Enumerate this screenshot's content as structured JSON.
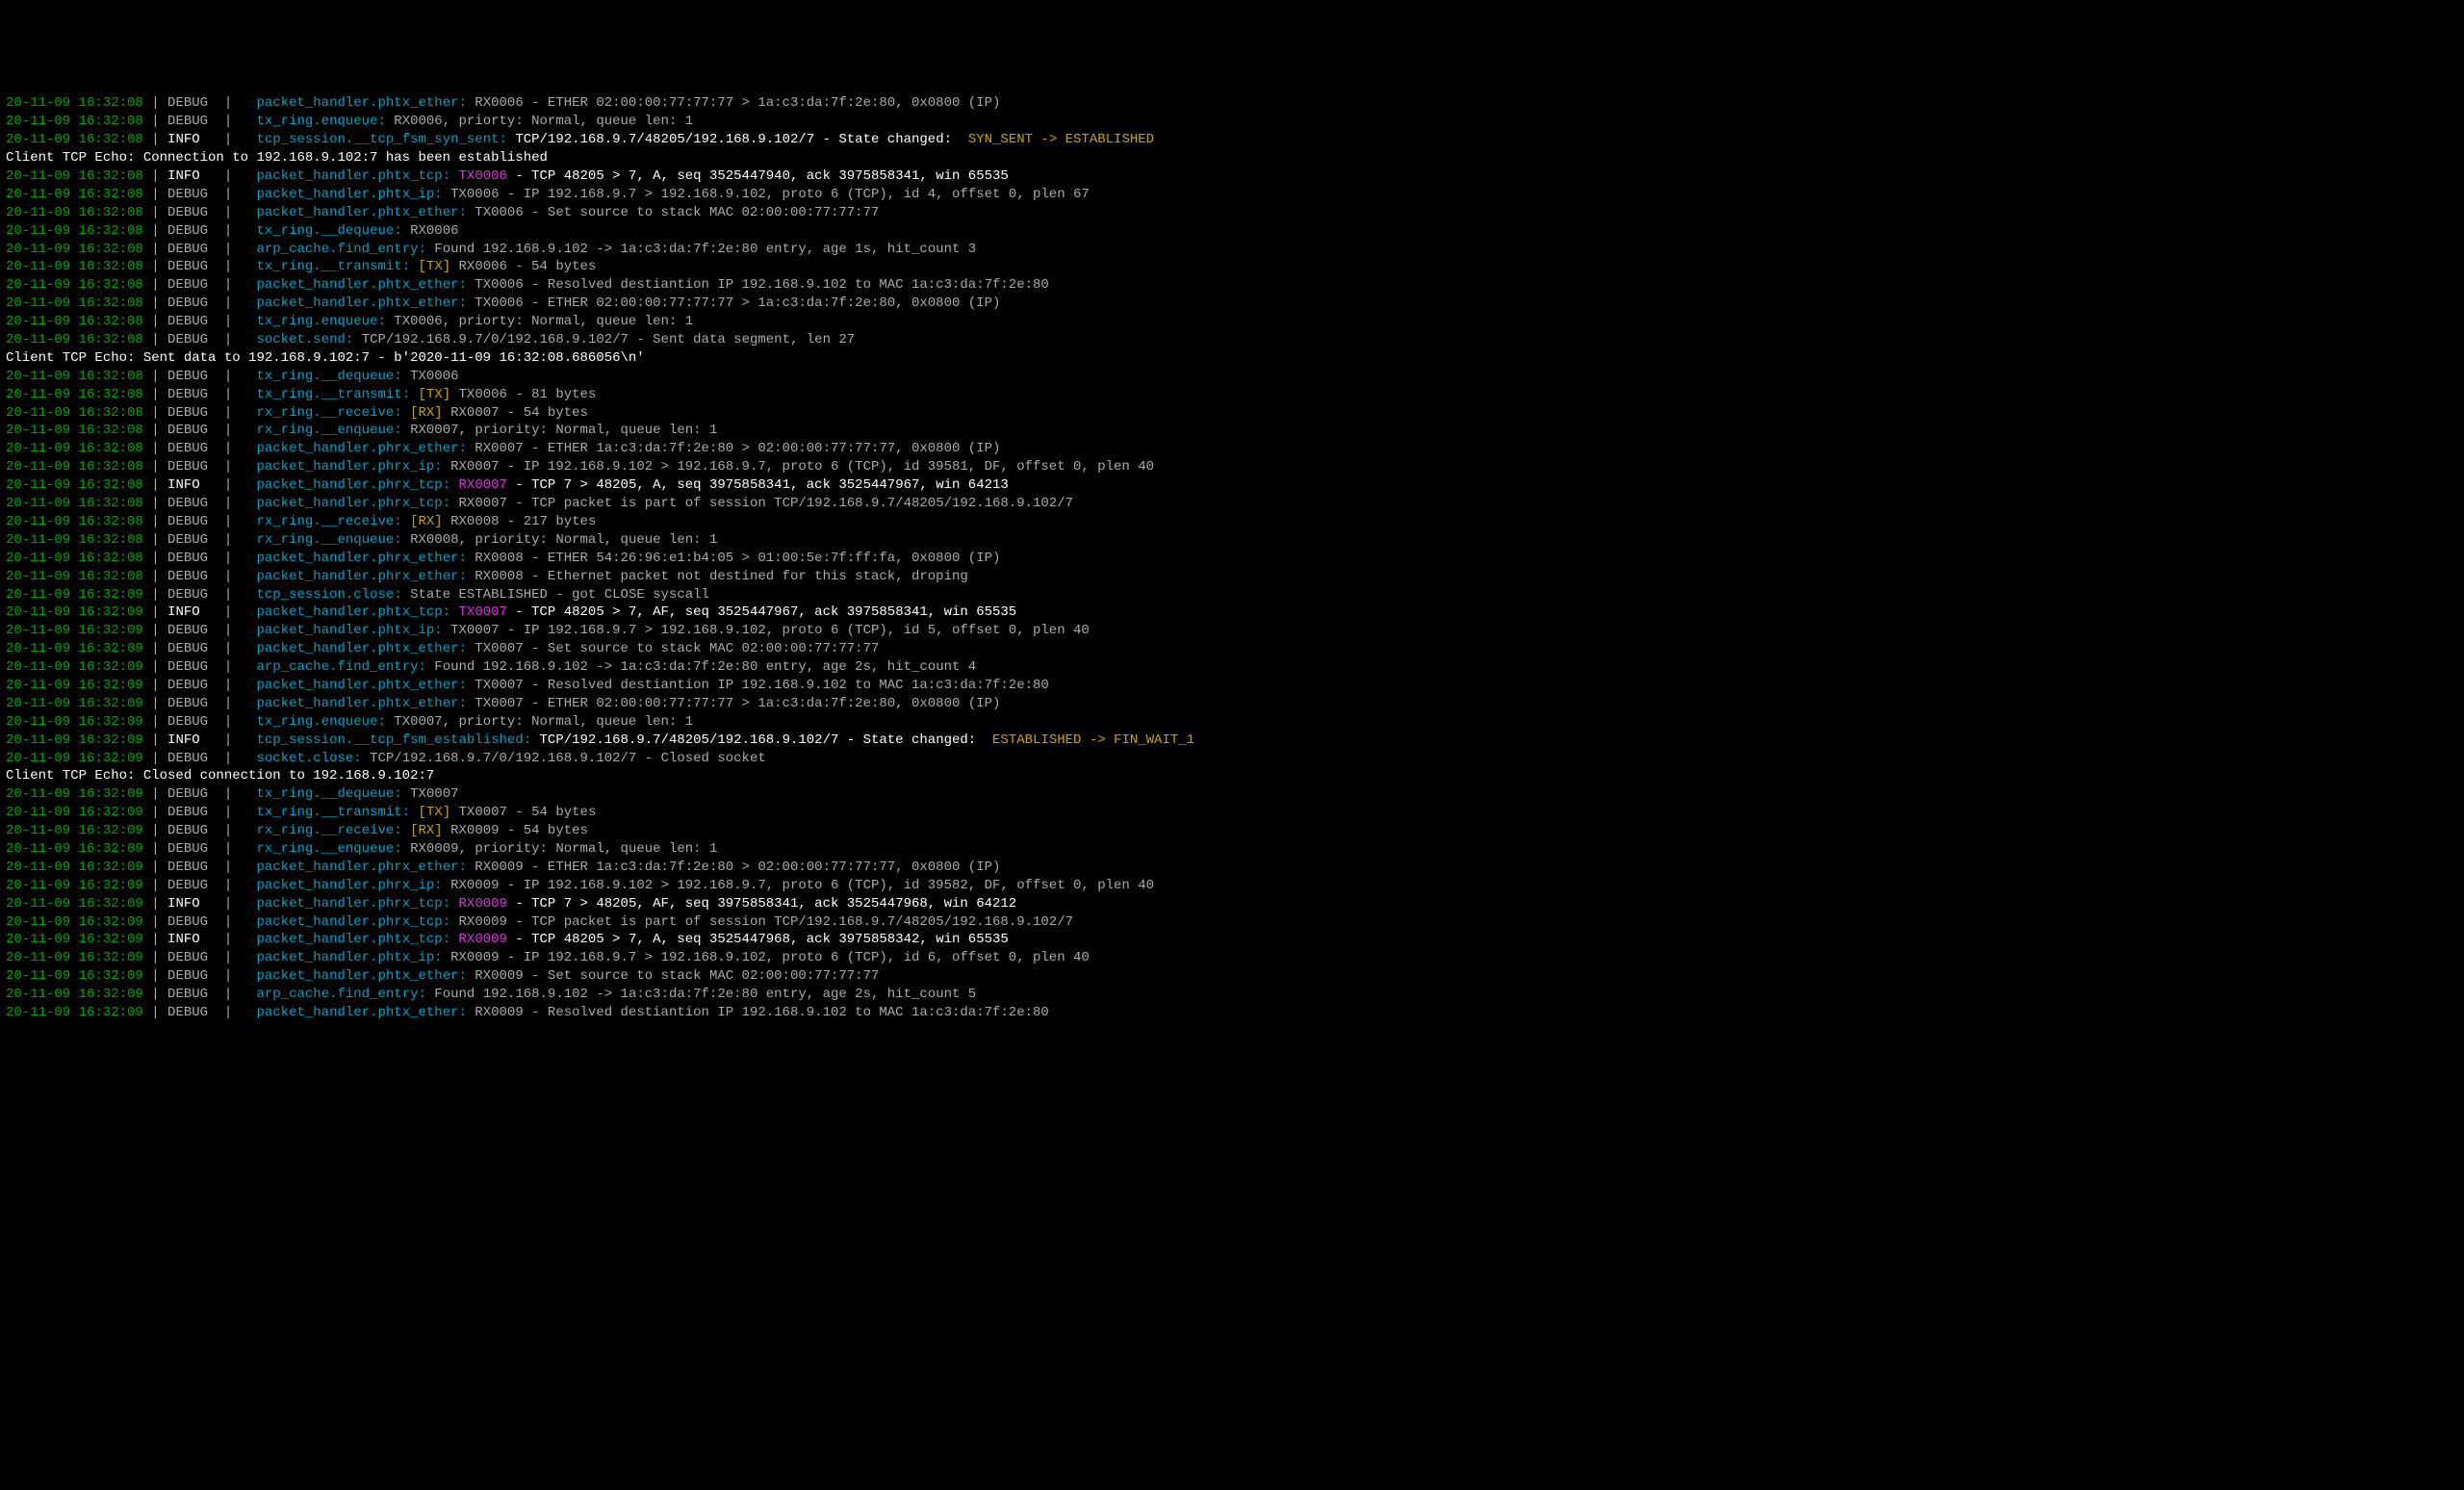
{
  "lines": [
    {
      "type": "log",
      "ts": "20-11-09 16:32:08",
      "level": "DEBUG",
      "module": "packet_handler.phtx_ether:",
      "segments": [
        {
          "cls": "msg",
          "t": " RX0006 - ETHER 02:00:00:77:77:77 > 1a:c3:da:7f:2e:80, 0x0800 (IP)"
        }
      ]
    },
    {
      "type": "log",
      "ts": "20-11-09 16:32:08",
      "level": "DEBUG",
      "module": "tx_ring.enqueue:",
      "segments": [
        {
          "cls": "msg",
          "t": " RX0006, priorty: Normal, queue len: 1"
        }
      ]
    },
    {
      "type": "log",
      "ts": "20-11-09 16:32:08",
      "level": "INFO",
      "module": "tcp_session.__tcp_fsm_syn_sent:",
      "segments": [
        {
          "cls": "white",
          "t": " TCP/192.168.9.7/48205/192.168.9.102/7 - State changed:  "
        },
        {
          "cls": "yellow",
          "t": "SYN_SENT -> ESTABLISHED"
        }
      ]
    },
    {
      "type": "plain",
      "segments": [
        {
          "cls": "plain",
          "t": "Client TCP Echo: Connection to 192.168.9.102:7 has been established"
        }
      ]
    },
    {
      "type": "log",
      "ts": "20-11-09 16:32:08",
      "level": "INFO",
      "module": "packet_handler.phtx_tcp:",
      "segments": [
        {
          "cls": "magenta",
          "t": " TX0006"
        },
        {
          "cls": "white",
          "t": " - TCP 48205 > 7, A, seq 3525447940, ack 3975858341, win 65535"
        }
      ]
    },
    {
      "type": "log",
      "ts": "20-11-09 16:32:08",
      "level": "DEBUG",
      "module": "packet_handler.phtx_ip:",
      "segments": [
        {
          "cls": "msg",
          "t": " TX0006 - IP 192.168.9.7 > 192.168.9.102, proto 6 (TCP), id 4, offset 0, plen 67"
        }
      ]
    },
    {
      "type": "log",
      "ts": "20-11-09 16:32:08",
      "level": "DEBUG",
      "module": "packet_handler.phtx_ether:",
      "segments": [
        {
          "cls": "msg",
          "t": " TX0006 - Set source to stack MAC 02:00:00:77:77:77"
        }
      ]
    },
    {
      "type": "log",
      "ts": "20-11-09 16:32:08",
      "level": "DEBUG",
      "module": "tx_ring.__dequeue:",
      "segments": [
        {
          "cls": "msg",
          "t": " RX0006"
        }
      ]
    },
    {
      "type": "log",
      "ts": "20-11-09 16:32:08",
      "level": "DEBUG",
      "module": "arp_cache.find_entry:",
      "segments": [
        {
          "cls": "msg",
          "t": " Found 192.168.9.102 -> 1a:c3:da:7f:2e:80 entry, age 1s, hit_count 3"
        }
      ]
    },
    {
      "type": "log",
      "ts": "20-11-09 16:32:08",
      "level": "DEBUG",
      "module": "tx_ring.__transmit:",
      "segments": [
        {
          "cls": "yellow",
          "t": " [TX]"
        },
        {
          "cls": "msg",
          "t": " RX0006 - 54 bytes"
        }
      ]
    },
    {
      "type": "log",
      "ts": "20-11-09 16:32:08",
      "level": "DEBUG",
      "module": "packet_handler.phtx_ether:",
      "segments": [
        {
          "cls": "msg",
          "t": " TX0006 - Resolved destiantion IP 192.168.9.102 to MAC 1a:c3:da:7f:2e:80"
        }
      ]
    },
    {
      "type": "log",
      "ts": "20-11-09 16:32:08",
      "level": "DEBUG",
      "module": "packet_handler.phtx_ether:",
      "segments": [
        {
          "cls": "msg",
          "t": " TX0006 - ETHER 02:00:00:77:77:77 > 1a:c3:da:7f:2e:80, 0x0800 (IP)"
        }
      ]
    },
    {
      "type": "log",
      "ts": "20-11-09 16:32:08",
      "level": "DEBUG",
      "module": "tx_ring.enqueue:",
      "segments": [
        {
          "cls": "msg",
          "t": " TX0006, priorty: Normal, queue len: 1"
        }
      ]
    },
    {
      "type": "log",
      "ts": "20-11-09 16:32:08",
      "level": "DEBUG",
      "module": "socket.send:",
      "segments": [
        {
          "cls": "msg",
          "t": " TCP/192.168.9.7/0/192.168.9.102/7 - Sent data segment, len 27"
        }
      ]
    },
    {
      "type": "plain",
      "segments": [
        {
          "cls": "plain",
          "t": "Client TCP Echo: Sent data to 192.168.9.102:7 - b'2020-11-09 16:32:08.686056\\n'"
        }
      ]
    },
    {
      "type": "log",
      "ts": "20-11-09 16:32:08",
      "level": "DEBUG",
      "module": "tx_ring.__dequeue:",
      "segments": [
        {
          "cls": "msg",
          "t": " TX0006"
        }
      ]
    },
    {
      "type": "log",
      "ts": "20-11-09 16:32:08",
      "level": "DEBUG",
      "module": "tx_ring.__transmit:",
      "segments": [
        {
          "cls": "yellow",
          "t": " [TX]"
        },
        {
          "cls": "msg",
          "t": " TX0006 - 81 bytes"
        }
      ]
    },
    {
      "type": "log",
      "ts": "20-11-09 16:32:08",
      "level": "DEBUG",
      "module": "rx_ring.__receive:",
      "segments": [
        {
          "cls": "yellow",
          "t": " [RX]"
        },
        {
          "cls": "msg",
          "t": " RX0007 - 54 bytes"
        }
      ]
    },
    {
      "type": "log",
      "ts": "20-11-09 16:32:08",
      "level": "DEBUG",
      "module": "rx_ring.__enqueue:",
      "segments": [
        {
          "cls": "msg",
          "t": " RX0007, priority: Normal, queue len: 1"
        }
      ]
    },
    {
      "type": "log",
      "ts": "20-11-09 16:32:08",
      "level": "DEBUG",
      "module": "packet_handler.phrx_ether:",
      "segments": [
        {
          "cls": "msg",
          "t": " RX0007 - ETHER 1a:c3:da:7f:2e:80 > 02:00:00:77:77:77, 0x0800 (IP)"
        }
      ]
    },
    {
      "type": "log",
      "ts": "20-11-09 16:32:08",
      "level": "DEBUG",
      "module": "packet_handler.phrx_ip:",
      "segments": [
        {
          "cls": "msg",
          "t": " RX0007 - IP 192.168.9.102 > 192.168.9.7, proto 6 (TCP), id 39581, DF, offset 0, plen 40"
        }
      ]
    },
    {
      "type": "log",
      "ts": "20-11-09 16:32:08",
      "level": "INFO",
      "module": "packet_handler.phrx_tcp:",
      "segments": [
        {
          "cls": "magenta",
          "t": " RX0007"
        },
        {
          "cls": "white",
          "t": " - TCP 7 > 48205, A, seq 3975858341, ack 3525447967, win 64213"
        }
      ]
    },
    {
      "type": "log",
      "ts": "20-11-09 16:32:08",
      "level": "DEBUG",
      "module": "packet_handler.phrx_tcp:",
      "segments": [
        {
          "cls": "msg",
          "t": " RX0007 - TCP packet is part of session TCP/192.168.9.7/48205/192.168.9.102/7"
        }
      ]
    },
    {
      "type": "log",
      "ts": "20-11-09 16:32:08",
      "level": "DEBUG",
      "module": "rx_ring.__receive:",
      "segments": [
        {
          "cls": "yellow",
          "t": " [RX]"
        },
        {
          "cls": "msg",
          "t": " RX0008 - 217 bytes"
        }
      ]
    },
    {
      "type": "log",
      "ts": "20-11-09 16:32:08",
      "level": "DEBUG",
      "module": "rx_ring.__enqueue:",
      "segments": [
        {
          "cls": "msg",
          "t": " RX0008, priority: Normal, queue len: 1"
        }
      ]
    },
    {
      "type": "log",
      "ts": "20-11-09 16:32:08",
      "level": "DEBUG",
      "module": "packet_handler.phrx_ether:",
      "segments": [
        {
          "cls": "msg",
          "t": " RX0008 - ETHER 54:26:96:e1:b4:05 > 01:00:5e:7f:ff:fa, 0x0800 (IP)"
        }
      ]
    },
    {
      "type": "log",
      "ts": "20-11-09 16:32:08",
      "level": "DEBUG",
      "module": "packet_handler.phrx_ether:",
      "segments": [
        {
          "cls": "msg",
          "t": " RX0008 - Ethernet packet not destined for this stack, droping"
        }
      ]
    },
    {
      "type": "log",
      "ts": "20-11-09 16:32:09",
      "level": "DEBUG",
      "module": "tcp_session.close:",
      "segments": [
        {
          "cls": "msg",
          "t": " State ESTABLISHED - got CLOSE syscall"
        }
      ]
    },
    {
      "type": "log",
      "ts": "20-11-09 16:32:09",
      "level": "INFO",
      "module": "packet_handler.phtx_tcp:",
      "segments": [
        {
          "cls": "magenta",
          "t": " TX0007"
        },
        {
          "cls": "white",
          "t": " - TCP 48205 > 7, AF, seq 3525447967, ack 3975858341, win 65535"
        }
      ]
    },
    {
      "type": "log",
      "ts": "20-11-09 16:32:09",
      "level": "DEBUG",
      "module": "packet_handler.phtx_ip:",
      "segments": [
        {
          "cls": "msg",
          "t": " TX0007 - IP 192.168.9.7 > 192.168.9.102, proto 6 (TCP), id 5, offset 0, plen 40"
        }
      ]
    },
    {
      "type": "log",
      "ts": "20-11-09 16:32:09",
      "level": "DEBUG",
      "module": "packet_handler.phtx_ether:",
      "segments": [
        {
          "cls": "msg",
          "t": " TX0007 - Set source to stack MAC 02:00:00:77:77:77"
        }
      ]
    },
    {
      "type": "log",
      "ts": "20-11-09 16:32:09",
      "level": "DEBUG",
      "module": "arp_cache.find_entry:",
      "segments": [
        {
          "cls": "msg",
          "t": " Found 192.168.9.102 -> 1a:c3:da:7f:2e:80 entry, age 2s, hit_count 4"
        }
      ]
    },
    {
      "type": "log",
      "ts": "20-11-09 16:32:09",
      "level": "DEBUG",
      "module": "packet_handler.phtx_ether:",
      "segments": [
        {
          "cls": "msg",
          "t": " TX0007 - Resolved destiantion IP 192.168.9.102 to MAC 1a:c3:da:7f:2e:80"
        }
      ]
    },
    {
      "type": "log",
      "ts": "20-11-09 16:32:09",
      "level": "DEBUG",
      "module": "packet_handler.phtx_ether:",
      "segments": [
        {
          "cls": "msg",
          "t": " TX0007 - ETHER 02:00:00:77:77:77 > 1a:c3:da:7f:2e:80, 0x0800 (IP)"
        }
      ]
    },
    {
      "type": "log",
      "ts": "20-11-09 16:32:09",
      "level": "DEBUG",
      "module": "tx_ring.enqueue:",
      "segments": [
        {
          "cls": "msg",
          "t": " TX0007, priorty: Normal, queue len: 1"
        }
      ]
    },
    {
      "type": "log",
      "ts": "20-11-09 16:32:09",
      "level": "INFO",
      "module": "tcp_session.__tcp_fsm_established:",
      "segments": [
        {
          "cls": "white",
          "t": " TCP/192.168.9.7/48205/192.168.9.102/7 - State changed:  "
        },
        {
          "cls": "yellow",
          "t": "ESTABLISHED -> FIN_WAIT_1"
        }
      ]
    },
    {
      "type": "log",
      "ts": "20-11-09 16:32:09",
      "level": "DEBUG",
      "module": "socket.close:",
      "segments": [
        {
          "cls": "msg",
          "t": " TCP/192.168.9.7/0/192.168.9.102/7 - Closed socket"
        }
      ]
    },
    {
      "type": "plain",
      "segments": [
        {
          "cls": "plain",
          "t": "Client TCP Echo: Closed connection to 192.168.9.102:7"
        }
      ]
    },
    {
      "type": "log",
      "ts": "20-11-09 16:32:09",
      "level": "DEBUG",
      "module": "tx_ring.__dequeue:",
      "segments": [
        {
          "cls": "msg",
          "t": " TX0007"
        }
      ]
    },
    {
      "type": "log",
      "ts": "20-11-09 16:32:09",
      "level": "DEBUG",
      "module": "tx_ring.__transmit:",
      "segments": [
        {
          "cls": "yellow",
          "t": " [TX]"
        },
        {
          "cls": "msg",
          "t": " TX0007 - 54 bytes"
        }
      ]
    },
    {
      "type": "log",
      "ts": "20-11-09 16:32:09",
      "level": "DEBUG",
      "module": "rx_ring.__receive:",
      "segments": [
        {
          "cls": "yellow",
          "t": " [RX]"
        },
        {
          "cls": "msg",
          "t": " RX0009 - 54 bytes"
        }
      ]
    },
    {
      "type": "log",
      "ts": "20-11-09 16:32:09",
      "level": "DEBUG",
      "module": "rx_ring.__enqueue:",
      "segments": [
        {
          "cls": "msg",
          "t": " RX0009, priority: Normal, queue len: 1"
        }
      ]
    },
    {
      "type": "log",
      "ts": "20-11-09 16:32:09",
      "level": "DEBUG",
      "module": "packet_handler.phrx_ether:",
      "segments": [
        {
          "cls": "msg",
          "t": " RX0009 - ETHER 1a:c3:da:7f:2e:80 > 02:00:00:77:77:77, 0x0800 (IP)"
        }
      ]
    },
    {
      "type": "log",
      "ts": "20-11-09 16:32:09",
      "level": "DEBUG",
      "module": "packet_handler.phrx_ip:",
      "segments": [
        {
          "cls": "msg",
          "t": " RX0009 - IP 192.168.9.102 > 192.168.9.7, proto 6 (TCP), id 39582, DF, offset 0, plen 40"
        }
      ]
    },
    {
      "type": "log",
      "ts": "20-11-09 16:32:09",
      "level": "INFO",
      "module": "packet_handler.phrx_tcp:",
      "segments": [
        {
          "cls": "magenta",
          "t": " RX0009"
        },
        {
          "cls": "white",
          "t": " - TCP 7 > 48205, AF, seq 3975858341, ack 3525447968, win 64212"
        }
      ]
    },
    {
      "type": "log",
      "ts": "20-11-09 16:32:09",
      "level": "DEBUG",
      "module": "packet_handler.phrx_tcp:",
      "segments": [
        {
          "cls": "msg",
          "t": " RX0009 - TCP packet is part of session TCP/192.168.9.7/48205/192.168.9.102/7"
        }
      ]
    },
    {
      "type": "log",
      "ts": "20-11-09 16:32:09",
      "level": "INFO",
      "module": "packet_handler.phtx_tcp:",
      "segments": [
        {
          "cls": "magenta",
          "t": " RX0009"
        },
        {
          "cls": "white",
          "t": " - TCP 48205 > 7, A, seq 3525447968, ack 3975858342, win 65535"
        }
      ]
    },
    {
      "type": "log",
      "ts": "20-11-09 16:32:09",
      "level": "DEBUG",
      "module": "packet_handler.phtx_ip:",
      "segments": [
        {
          "cls": "msg",
          "t": " RX0009 - IP 192.168.9.7 > 192.168.9.102, proto 6 (TCP), id 6, offset 0, plen 40"
        }
      ]
    },
    {
      "type": "log",
      "ts": "20-11-09 16:32:09",
      "level": "DEBUG",
      "module": "packet_handler.phtx_ether:",
      "segments": [
        {
          "cls": "msg",
          "t": " RX0009 - Set source to stack MAC 02:00:00:77:77:77"
        }
      ]
    },
    {
      "type": "log",
      "ts": "20-11-09 16:32:09",
      "level": "DEBUG",
      "module": "arp_cache.find_entry:",
      "segments": [
        {
          "cls": "msg",
          "t": " Found 192.168.9.102 -> 1a:c3:da:7f:2e:80 entry, age 2s, hit_count 5"
        }
      ]
    },
    {
      "type": "log",
      "ts": "20-11-09 16:32:09",
      "level": "DEBUG",
      "module": "packet_handler.phtx_ether:",
      "segments": [
        {
          "cls": "msg",
          "t": " RX0009 - Resolved destiantion IP 192.168.9.102 to MAC 1a:c3:da:7f:2e:80"
        }
      ]
    }
  ]
}
